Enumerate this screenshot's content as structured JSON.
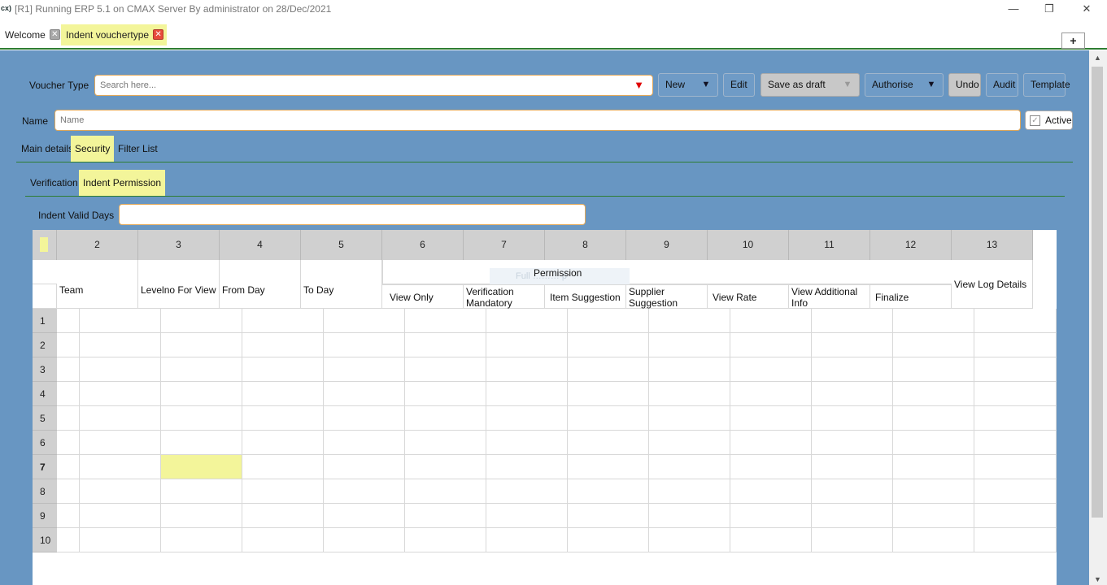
{
  "window": {
    "app_icon": "cx)",
    "title": "[R1] Running ERP 5.1 on CMAX Server By administrator on 28/Dec/2021",
    "minimize_glyph": "—",
    "restore_glyph": "❐",
    "close_glyph": "✕"
  },
  "tabs": [
    {
      "label": "Welcome",
      "close_glyph": "✕"
    },
    {
      "label": "Indent vouchertype",
      "close_glyph": "✕"
    }
  ],
  "add_tab_glyph": "+",
  "toolbar": {
    "voucher_type_label": "Voucher Type",
    "search_placeholder": "Search here...",
    "dropdown_glyph": "▼",
    "new_label": "New",
    "edit_label": "Edit",
    "save_draft_label": "Save as draft",
    "authorise_label": "Authorise",
    "undo_label": "Undo",
    "audit_label": "Audit",
    "template_label": "Template",
    "caret_glyph": "▼"
  },
  "name_row": {
    "label": "Name",
    "placeholder": "Name",
    "active_label": "Active",
    "active_checked": true,
    "check_glyph": "✓"
  },
  "main_tabs": [
    "Main details",
    "Security",
    "Filter List"
  ],
  "sub_tabs": [
    "Verification",
    "Indent Permission"
  ],
  "valid_days": {
    "label": "Indent Valid Days",
    "value": ""
  },
  "grid": {
    "column_numbers": [
      "2",
      "3",
      "4",
      "5",
      "6",
      "7",
      "8",
      "9",
      "10",
      "11",
      "12",
      "13"
    ],
    "group_header": "Permission",
    "ghost_text": "Full ……… p",
    "headers": {
      "team": "Team",
      "levelno": "Levelno For View",
      "from_day": "From Day",
      "to_day": "To Day",
      "view_only": "View Only",
      "verification_mandatory": "Verification Mandatory",
      "item_suggestion": "Item Suggestion",
      "supplier_suggestion": "Supplier Suggestion",
      "view_rate": "View Rate",
      "view_additional_info": "View Additional Info",
      "finalize": "Finalize",
      "view_log_details": "View Log Details"
    },
    "row_numbers": [
      "1",
      "2",
      "3",
      "4",
      "5",
      "6",
      "7",
      "8",
      "9",
      "10"
    ],
    "selected_row": "7"
  },
  "colors": {
    "panel": "#6896c2",
    "highlight": "#f3f59a",
    "accent_green": "#2e7d32",
    "field_border": "#e3a95a",
    "dropdown_red": "#e00000"
  }
}
